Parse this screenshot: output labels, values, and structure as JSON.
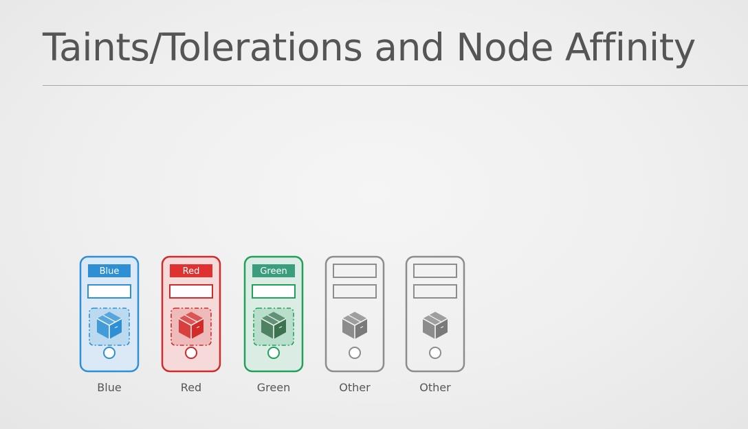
{
  "slide": {
    "title": "Taints/Tolerations and Node Affinity"
  },
  "nodes": [
    {
      "name": "Blue",
      "label": "Blue",
      "caption": "Blue",
      "has_pod": true,
      "color": "#2e8fd4",
      "label_fill": "#2e8fd4",
      "body_fill": "#dbe9f6",
      "pod_color": "#2e8fd4",
      "icon": "cube-icon"
    },
    {
      "name": "Red",
      "label": "Red",
      "caption": "Red",
      "has_pod": true,
      "color": "#d02a2a",
      "label_fill": "#e03131",
      "body_fill": "#f6dada",
      "pod_color": "#d42a2a",
      "icon": "cube-icon"
    },
    {
      "name": "Green",
      "label": "Green",
      "caption": "Green",
      "has_pod": true,
      "color": "#22a05a",
      "label_fill": "#3a9e7e",
      "body_fill": "#dbece4",
      "pod_color": "#3c7250",
      "icon": "cube-icon"
    },
    {
      "name": "Other",
      "label": "",
      "caption": "Other",
      "has_pod": false,
      "color": "#8c8c8c",
      "label_fill": "none",
      "body_fill": "none",
      "pod_color": "#7a7a7a",
      "icon": "cube-icon"
    },
    {
      "name": "Other",
      "label": "",
      "caption": "Other",
      "has_pod": false,
      "color": "#8c8c8c",
      "label_fill": "none",
      "body_fill": "none",
      "pod_color": "#7a7a7a",
      "icon": "cube-icon"
    }
  ]
}
